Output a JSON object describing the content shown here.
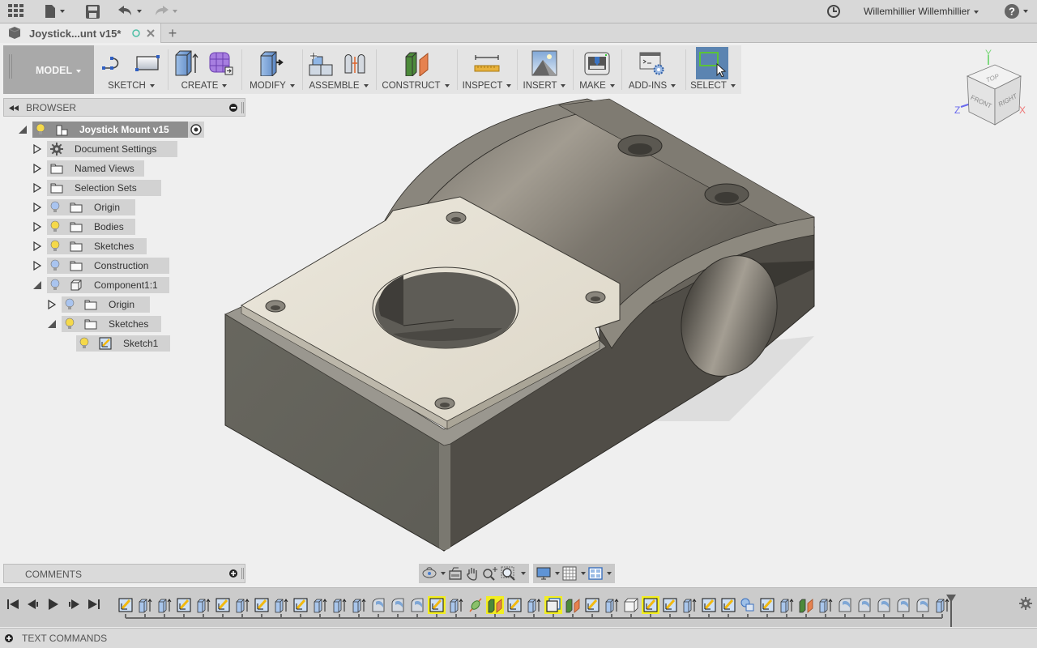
{
  "titlebar": {
    "user_name": "Willemhillier Willemhillier",
    "icons": [
      "app-grid-icon",
      "file-icon",
      "save-icon",
      "undo-icon",
      "redo-icon",
      "job-status-icon",
      "help-icon"
    ]
  },
  "tabs": {
    "document_title": "Joystick...unt v15*",
    "new_tab_label": "+"
  },
  "toolbar": {
    "workspace": "MODEL",
    "groups": [
      {
        "label": "SKETCH"
      },
      {
        "label": "CREATE"
      },
      {
        "label": "MODIFY"
      },
      {
        "label": "ASSEMBLE"
      },
      {
        "label": "CONSTRUCT"
      },
      {
        "label": "INSPECT"
      },
      {
        "label": "INSERT"
      },
      {
        "label": "MAKE"
      },
      {
        "label": "ADD-INS"
      },
      {
        "label": "SELECT"
      }
    ]
  },
  "viewcube": {
    "faces": {
      "top": "TOP",
      "front": "FRONT",
      "right": "RIGHT"
    },
    "axes": {
      "x": "X",
      "y": "Y",
      "z": "Z"
    },
    "colors": {
      "x": "#ee7777",
      "y": "#77dd77",
      "z": "#6a6aee"
    }
  },
  "browser": {
    "title": "BROWSER",
    "items": [
      {
        "label": "Joystick Mount v15",
        "level": 0,
        "expanded": true,
        "icon": "component-icon",
        "light": "on"
      },
      {
        "label": "Document Settings",
        "level": 1,
        "expanded": false,
        "icon": "gear-icon",
        "light": "none"
      },
      {
        "label": "Named Views",
        "level": 1,
        "expanded": false,
        "icon": "folder-icon",
        "light": "none"
      },
      {
        "label": "Selection Sets",
        "level": 1,
        "expanded": false,
        "icon": "folder-icon",
        "light": "none"
      },
      {
        "label": "Origin",
        "level": 1,
        "expanded": false,
        "icon": "folder-icon",
        "light": "off"
      },
      {
        "label": "Bodies",
        "level": 1,
        "expanded": false,
        "icon": "folder-icon",
        "light": "on"
      },
      {
        "label": "Sketches",
        "level": 1,
        "expanded": false,
        "icon": "folder-icon",
        "light": "on"
      },
      {
        "label": "Construction",
        "level": 1,
        "expanded": false,
        "icon": "folder-icon",
        "light": "off"
      },
      {
        "label": "Component1:1",
        "level": 1,
        "expanded": true,
        "icon": "body-icon",
        "light": "off"
      },
      {
        "label": "Origin",
        "level": 2,
        "expanded": false,
        "icon": "folder-icon",
        "light": "off"
      },
      {
        "label": "Sketches",
        "level": 2,
        "expanded": true,
        "icon": "folder-icon",
        "light": "on"
      },
      {
        "label": "Sketch1",
        "level": 3,
        "expanded": null,
        "icon": "sketch-icon",
        "light": "on"
      }
    ]
  },
  "comments": {
    "title": "COMMENTS"
  },
  "text_commands": {
    "title": "TEXT COMMANDS"
  },
  "navbar": {
    "tools": [
      "orbit-icon",
      "look-at-icon",
      "pan-icon",
      "zoom-icon",
      "zoom-window-icon",
      "display-settings-icon",
      "grid-icon",
      "viewports-icon"
    ]
  },
  "timeline": {
    "controls": [
      "first",
      "previous",
      "play",
      "next",
      "last"
    ],
    "features": [
      {
        "type": "sketch",
        "highlighted": false
      },
      {
        "type": "extrude",
        "highlighted": false
      },
      {
        "type": "extrude",
        "highlighted": false
      },
      {
        "type": "sketch",
        "highlighted": false
      },
      {
        "type": "extrude",
        "highlighted": false
      },
      {
        "type": "sketch",
        "highlighted": false
      },
      {
        "type": "extrude",
        "highlighted": false
      },
      {
        "type": "sketch",
        "highlighted": false
      },
      {
        "type": "extrude",
        "highlighted": false
      },
      {
        "type": "sketch",
        "highlighted": false
      },
      {
        "type": "extrude",
        "highlighted": false
      },
      {
        "type": "extrude",
        "highlighted": false
      },
      {
        "type": "extrude",
        "highlighted": false
      },
      {
        "type": "fillet",
        "highlighted": false
      },
      {
        "type": "fillet",
        "highlighted": false
      },
      {
        "type": "fillet",
        "highlighted": false
      },
      {
        "type": "sketch",
        "highlighted": true
      },
      {
        "type": "extrude",
        "highlighted": false
      },
      {
        "type": "axis",
        "highlighted": false
      },
      {
        "type": "plane",
        "highlighted": true
      },
      {
        "type": "sketch",
        "highlighted": false
      },
      {
        "type": "extrude",
        "highlighted": false
      },
      {
        "type": "component",
        "highlighted": true
      },
      {
        "type": "plane",
        "highlighted": false
      },
      {
        "type": "sketch",
        "highlighted": false
      },
      {
        "type": "extrude",
        "highlighted": false
      },
      {
        "type": "box",
        "highlighted": false
      },
      {
        "type": "sketch",
        "highlighted": true
      },
      {
        "type": "sketch",
        "highlighted": false
      },
      {
        "type": "extrude",
        "highlighted": false
      },
      {
        "type": "sketch",
        "highlighted": false
      },
      {
        "type": "sketch",
        "highlighted": false
      },
      {
        "type": "move",
        "highlighted": false
      },
      {
        "type": "sketch",
        "highlighted": false
      },
      {
        "type": "extrude",
        "highlighted": false
      },
      {
        "type": "plane",
        "highlighted": false
      },
      {
        "type": "extrude",
        "highlighted": false
      },
      {
        "type": "fillet",
        "highlighted": false
      },
      {
        "type": "fillet",
        "highlighted": false
      },
      {
        "type": "fillet",
        "highlighted": false
      },
      {
        "type": "fillet",
        "highlighted": false
      },
      {
        "type": "fillet",
        "highlighted": false
      },
      {
        "type": "extrude",
        "highlighted": false
      }
    ]
  },
  "colors": {
    "accent_select": "#5b84b1",
    "timeline_highlight": "#f2ee21",
    "light_on": "#f5d94a",
    "light_off": "#a9c4ef"
  }
}
